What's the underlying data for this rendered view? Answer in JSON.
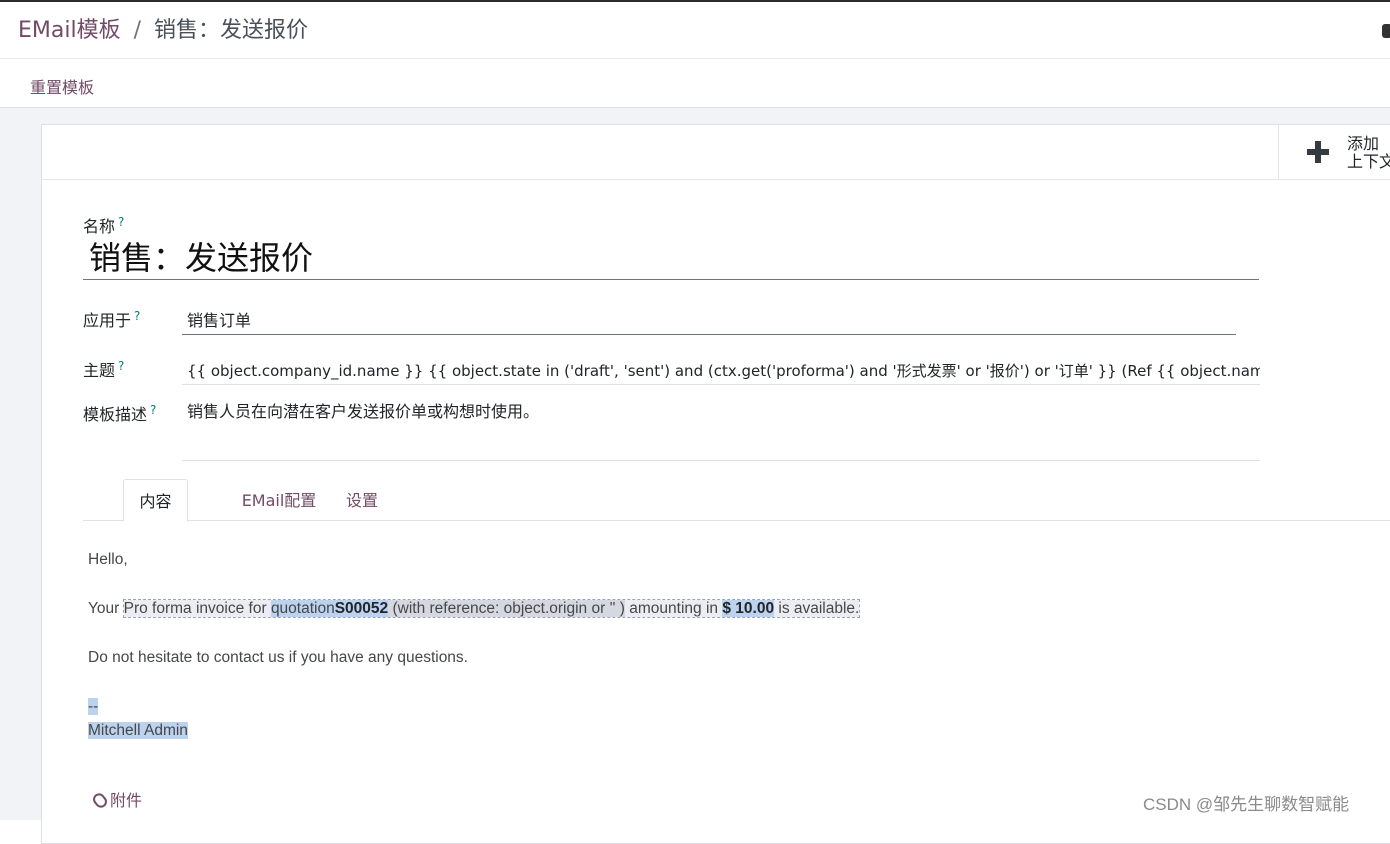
{
  "breadcrumb": {
    "parent": "EMail模板",
    "separator": "/",
    "current": "销售：发送报价"
  },
  "toolbar": {
    "reset_label": "重置模板"
  },
  "stat_button": {
    "line1": "添加",
    "line2": "上下文"
  },
  "form": {
    "name_label": "名称",
    "name_value": "销售：发送报价",
    "apply_label": "应用于",
    "apply_value": "销售订单",
    "subject_label": "主题",
    "subject_value": "{{ object.company_id.name }} {{ object.state in ('draft', 'sent') and (ctx.get('proforma') and '形式发票' or '报价') or '订单' }} (Ref {{ object.name or 'n/a' }})",
    "desc_label": "模板描述",
    "desc_value": "销售人员在向潜在客户发送报价单或构想时使用。",
    "help_mark": "?"
  },
  "tabs": [
    {
      "label": "内容"
    },
    {
      "label": "EMail配置"
    },
    {
      "label": "设置"
    }
  ],
  "content": {
    "greeting": "Hello,",
    "your": "Your ",
    "seg1": "Pro forma invoice for ",
    "seg2": "quotation",
    "seg3": "S00052",
    "seg4": " (with reference: object.origin or '' )",
    "seg5": " amounting in ",
    "seg6": "$ 10.00",
    "seg7": " is available.",
    "contact": "Do not hesitate to contact us if you have any questions.",
    "sig_dash": "--",
    "sig_name": "Mitchell Admin"
  },
  "attachments_label": "附件",
  "watermark": "CSDN @邹先生聊数智赋能"
}
